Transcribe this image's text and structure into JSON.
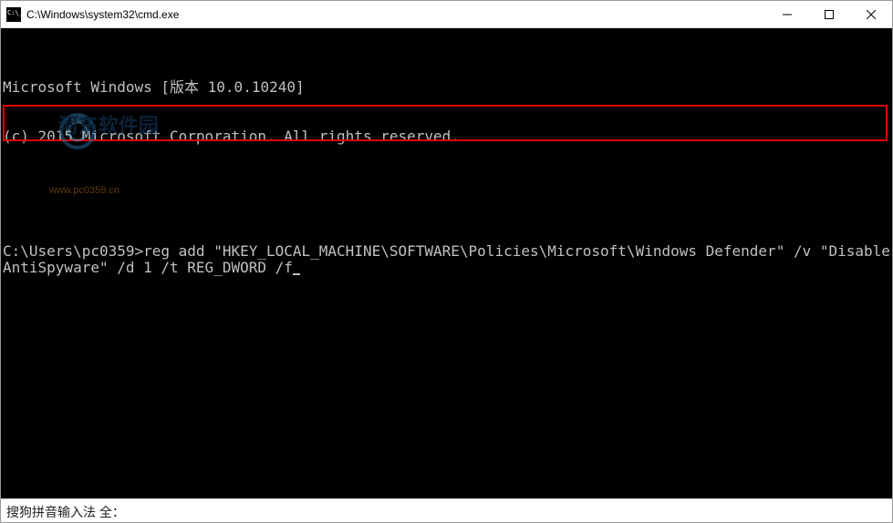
{
  "titlebar": {
    "title": "C:\\Windows\\system32\\cmd.exe"
  },
  "watermark": {
    "main_text": "河东软件园",
    "sub_text": "www.pc0359.cn"
  },
  "terminal": {
    "line1": "Microsoft Windows [版本 10.0.10240]",
    "line2": "(c) 2015 Microsoft Corporation. All rights reserved.",
    "blank": "",
    "prompt_line": "C:\\Users\\pc0359>reg add \"HKEY_LOCAL_MACHINE\\SOFTWARE\\Policies\\Microsoft\\Windows Defender\" /v \"DisableAntiSpyware\" /d 1 /t REG_DWORD /f"
  },
  "ime": {
    "status": "搜狗拼音输入法 全："
  }
}
